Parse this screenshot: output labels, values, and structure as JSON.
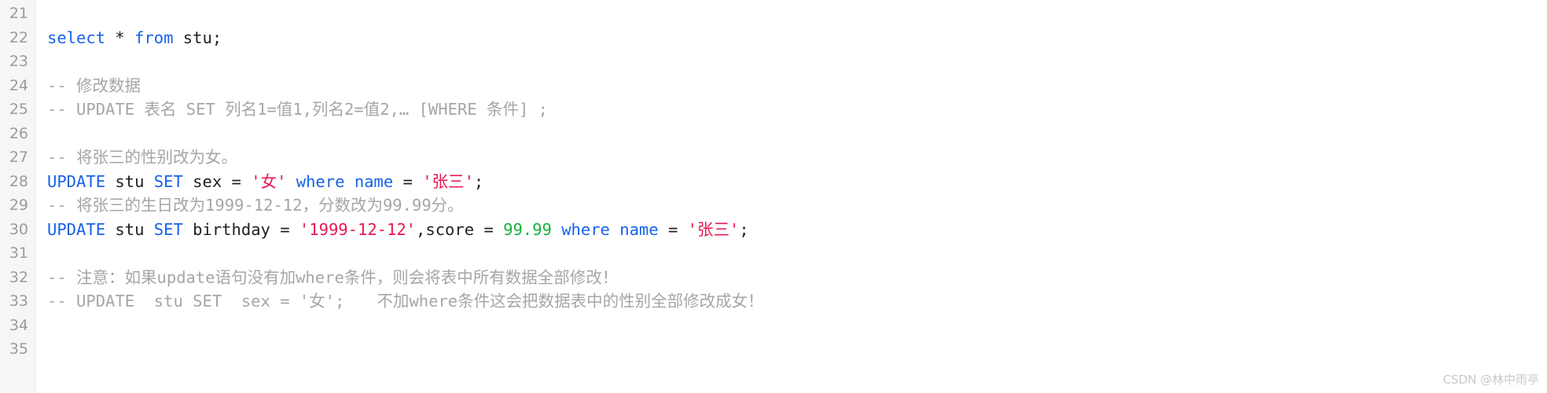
{
  "editor": {
    "first_line_number": 21,
    "colors": {
      "keyword": "#1862e8",
      "string": "#e8174e",
      "number": "#16b33a",
      "comment": "#a6a6a6",
      "plain": "#222222",
      "gutter_text": "#9b9b9b",
      "gutter_bg": "#f6f6f6",
      "background": "#ffffff"
    },
    "line_numbers": [
      "21",
      "22",
      "23",
      "24",
      "25",
      "26",
      "27",
      "28",
      "29",
      "30",
      "31",
      "32",
      "33",
      "34",
      "35"
    ],
    "lines": [
      {
        "number": "21",
        "tokens": []
      },
      {
        "number": "22",
        "tokens": [
          {
            "t": "select",
            "c": "kw"
          },
          {
            "t": " ",
            "c": "pl"
          },
          {
            "t": "*",
            "c": "pl"
          },
          {
            "t": " ",
            "c": "pl"
          },
          {
            "t": "from",
            "c": "kw"
          },
          {
            "t": " stu;",
            "c": "pl"
          }
        ]
      },
      {
        "number": "23",
        "tokens": []
      },
      {
        "number": "24",
        "tokens": [
          {
            "t": "-- ",
            "c": "cmt"
          },
          {
            "t": "修改数据",
            "c": "cmt cjk"
          }
        ]
      },
      {
        "number": "25",
        "tokens": [
          {
            "t": "-- UPDATE ",
            "c": "cmt"
          },
          {
            "t": "表名",
            "c": "cmt cjk"
          },
          {
            "t": " SET ",
            "c": "cmt"
          },
          {
            "t": "列名",
            "c": "cmt cjk"
          },
          {
            "t": "1=",
            "c": "cmt"
          },
          {
            "t": "值",
            "c": "cmt cjk"
          },
          {
            "t": "1,",
            "c": "cmt"
          },
          {
            "t": "列名",
            "c": "cmt cjk"
          },
          {
            "t": "2=",
            "c": "cmt"
          },
          {
            "t": "值",
            "c": "cmt cjk"
          },
          {
            "t": "2,… [WHERE ",
            "c": "cmt"
          },
          {
            "t": "条件",
            "c": "cmt cjk"
          },
          {
            "t": "] ;",
            "c": "cmt"
          }
        ]
      },
      {
        "number": "26",
        "tokens": []
      },
      {
        "number": "27",
        "tokens": [
          {
            "t": "-- ",
            "c": "cmt"
          },
          {
            "t": "将张三的性别改为女。",
            "c": "cmt cjk"
          }
        ]
      },
      {
        "number": "28",
        "tokens": [
          {
            "t": "UPDATE",
            "c": "kw"
          },
          {
            "t": " stu ",
            "c": "pl"
          },
          {
            "t": "SET",
            "c": "kw"
          },
          {
            "t": " sex ",
            "c": "pl"
          },
          {
            "t": "=",
            "c": "op"
          },
          {
            "t": " ",
            "c": "pl"
          },
          {
            "t": "'",
            "c": "str"
          },
          {
            "t": "女",
            "c": "str cjk"
          },
          {
            "t": "'",
            "c": "str"
          },
          {
            "t": " ",
            "c": "pl"
          },
          {
            "t": "where",
            "c": "kw"
          },
          {
            "t": " ",
            "c": "pl"
          },
          {
            "t": "name",
            "c": "kw"
          },
          {
            "t": " ",
            "c": "pl"
          },
          {
            "t": "=",
            "c": "op"
          },
          {
            "t": " ",
            "c": "pl"
          },
          {
            "t": "'",
            "c": "str"
          },
          {
            "t": "张三",
            "c": "str cjk"
          },
          {
            "t": "'",
            "c": "str"
          },
          {
            "t": ";",
            "c": "pl"
          }
        ]
      },
      {
        "number": "29",
        "tokens": [
          {
            "t": "-- ",
            "c": "cmt"
          },
          {
            "t": "将张三的生日改为",
            "c": "cmt cjk"
          },
          {
            "t": "1999-12-12",
            "c": "cmt"
          },
          {
            "t": "，分数改为",
            "c": "cmt cjk"
          },
          {
            "t": "99.99",
            "c": "cmt"
          },
          {
            "t": "分。",
            "c": "cmt cjk"
          }
        ]
      },
      {
        "number": "30",
        "tokens": [
          {
            "t": "UPDATE",
            "c": "kw"
          },
          {
            "t": " stu ",
            "c": "pl"
          },
          {
            "t": "SET",
            "c": "kw"
          },
          {
            "t": " birthday ",
            "c": "pl"
          },
          {
            "t": "=",
            "c": "op"
          },
          {
            "t": " ",
            "c": "pl"
          },
          {
            "t": "'1999-12-12'",
            "c": "str"
          },
          {
            "t": ",score ",
            "c": "pl"
          },
          {
            "t": "=",
            "c": "op"
          },
          {
            "t": " ",
            "c": "pl"
          },
          {
            "t": "99.99",
            "c": "num"
          },
          {
            "t": " ",
            "c": "pl"
          },
          {
            "t": "where",
            "c": "kw"
          },
          {
            "t": " ",
            "c": "pl"
          },
          {
            "t": "name",
            "c": "kw"
          },
          {
            "t": " ",
            "c": "pl"
          },
          {
            "t": "=",
            "c": "op"
          },
          {
            "t": " ",
            "c": "pl"
          },
          {
            "t": "'",
            "c": "str"
          },
          {
            "t": "张三",
            "c": "str cjk"
          },
          {
            "t": "'",
            "c": "str"
          },
          {
            "t": ";",
            "c": "pl"
          }
        ]
      },
      {
        "number": "31",
        "tokens": []
      },
      {
        "number": "32",
        "tokens": [
          {
            "t": "-- ",
            "c": "cmt"
          },
          {
            "t": "注意：如果",
            "c": "cmt cjk"
          },
          {
            "t": "update",
            "c": "cmt"
          },
          {
            "t": "语句没有加",
            "c": "cmt cjk"
          },
          {
            "t": "where",
            "c": "cmt"
          },
          {
            "t": "条件，则会将表中所有数据全部修改！",
            "c": "cmt cjk"
          }
        ]
      },
      {
        "number": "33",
        "tokens": [
          {
            "t": "-- UPDATE  stu SET  sex = '",
            "c": "cmt"
          },
          {
            "t": "女",
            "c": "cmt cjk"
          },
          {
            "t": "';",
            "c": "cmt"
          },
          {
            "t": "　　",
            "c": "cmt cjk"
          },
          {
            "t": "不加",
            "c": "cmt cjk"
          },
          {
            "t": "where",
            "c": "cmt"
          },
          {
            "t": "条件这会把数据表中的性别全部修改成女！",
            "c": "cmt cjk"
          }
        ]
      },
      {
        "number": "34",
        "tokens": []
      },
      {
        "number": "35",
        "tokens": []
      }
    ]
  },
  "watermark": {
    "text": "CSDN @林中雨亭"
  }
}
